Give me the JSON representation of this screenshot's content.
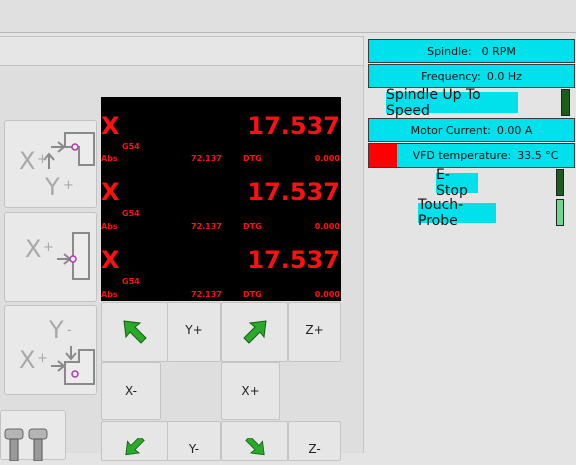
{
  "status": {
    "spindle_label": "Spindle:",
    "spindle_value": "0 RPM",
    "frequency_label": "Frequency:",
    "frequency_value": "0.0 Hz",
    "spindle_up_to_speed": "Spindle Up To Speed",
    "motor_current_label": "Motor Current:",
    "motor_current_value": "0.00 A",
    "vfd_temp_label": "VFD temperature:",
    "vfd_temp_value": "33.5 °C",
    "estop": "E-Stop",
    "touch_probe": "Touch-Probe"
  },
  "dro": {
    "rows": [
      {
        "axis": "X",
        "value": "17.537",
        "offset": "G54",
        "abs_label": "Abs",
        "abs": "72.137",
        "dtg_label": "DTG",
        "dtg": "0.000"
      },
      {
        "axis": "X",
        "value": "17.537",
        "offset": "G54",
        "abs_label": "Abs",
        "abs": "72.137",
        "dtg_label": "DTG",
        "dtg": "0.000"
      },
      {
        "axis": "X",
        "value": "17.537",
        "offset": "G54",
        "abs_label": "Abs",
        "abs": "72.137",
        "dtg_label": "DTG",
        "dtg": "0.000"
      }
    ]
  },
  "jog": {
    "y_plus": "Y+",
    "z_plus": "Z+",
    "x_minus": "X-",
    "x_plus": "X+",
    "y_minus": "Y-",
    "z_minus": "Z-"
  },
  "colors": {
    "status_bg": "#00e1ec",
    "led_green_dark": "#1c5c1c",
    "led_green_light": "#6fd48e",
    "vfd_red": "#ff0000",
    "dro_text": "#ff1010",
    "arrow_green": "#2aaa2a"
  }
}
